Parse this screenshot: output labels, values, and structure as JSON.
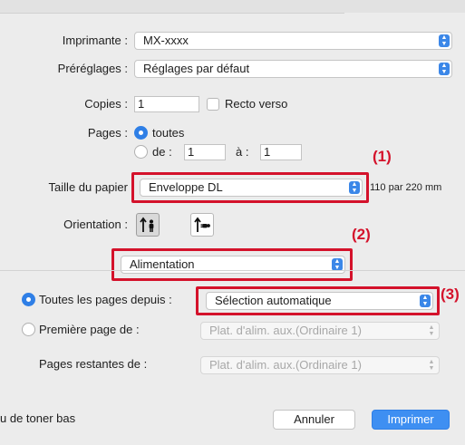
{
  "printer": {
    "label": "Imprimante :",
    "value": "MX-xxxx"
  },
  "presets": {
    "label": "Préréglages :",
    "value": "Réglages par défaut"
  },
  "copies": {
    "label": "Copies :",
    "value": "1",
    "duplex_label": "Recto verso"
  },
  "pages": {
    "label": "Pages :",
    "all_label": "toutes",
    "range_from_label": "de :",
    "from_value": "1",
    "range_to_label": "à :",
    "to_value": "1"
  },
  "paper_size": {
    "label": "Taille du papier",
    "value": "Enveloppe DL",
    "dimensions": "110 par 220 mm"
  },
  "orientation": {
    "label": "Orientation :",
    "selected": "portrait"
  },
  "panel_select": {
    "value": "Alimentation"
  },
  "feed": {
    "all_pages_from_label": "Toutes les pages depuis :",
    "all_pages_from_value": "Sélection automatique",
    "first_page_label": "Première page de :",
    "first_page_value": "Plat. d'alim. aux.(Ordinaire 1)",
    "remaining_pages_label": "Pages restantes de :",
    "remaining_pages_value": "Plat. d'alim. aux.(Ordinaire 1)"
  },
  "callouts": [
    "(1)",
    "(2)",
    "(3)"
  ],
  "footer": {
    "status_text": "u de toner bas",
    "cancel_label": "Annuler",
    "print_label": "Imprimer"
  },
  "colors": {
    "accent": "#3b87e8",
    "callout": "#d4122b"
  }
}
